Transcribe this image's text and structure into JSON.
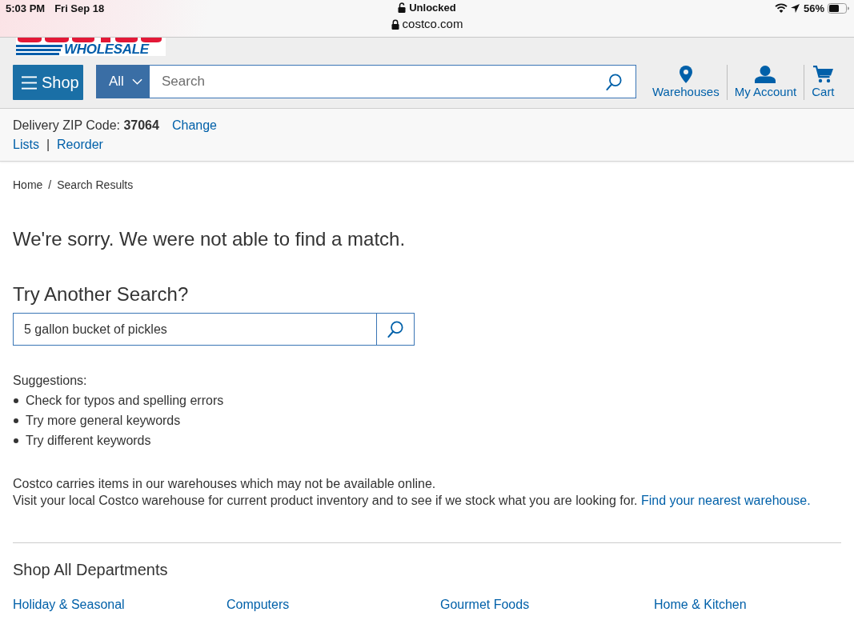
{
  "status_bar": {
    "time": "5:03 PM",
    "date": "Fri Sep 18",
    "lock_status": "Unlocked",
    "address": "costco.com",
    "battery": "56%"
  },
  "header": {
    "logo_text": "WHOLESALE",
    "shop_button": "Shop",
    "search_category": "All",
    "search_placeholder": "Search",
    "nav": [
      {
        "kind": "pin",
        "label": "Warehouses"
      },
      {
        "kind": "person",
        "label": "My Account"
      },
      {
        "kind": "cart",
        "label": "Cart"
      }
    ]
  },
  "delivery": {
    "zip_text": "Delivery ZIP Code: **37064**",
    "change_link": "Change",
    "links": [
      "Lists",
      "Reorder"
    ],
    "separator": "|"
  },
  "breadcrumb": {
    "items": [
      "Home",
      "Search Results"
    ],
    "separator": "/"
  },
  "no_results_message": "We're sorry. We were not able to find a match.",
  "retry_search": {
    "title": "Try Another Search?",
    "query": "5 gallon bucket of pickles"
  },
  "suggestions": {
    "title": "Suggestions:",
    "items": [
      "Check for typos and spelling errors",
      "Try more general keywords",
      "Try different keywords"
    ]
  },
  "notice": {
    "text": "Costco carries items in our warehouses which may not be available online.",
    "visit_text": "Visit your local Costco warehouse for current product inventory and to see if we stock what you are looking for.",
    "link": "Find your nearest warehouse."
  },
  "departments": {
    "title": "Shop All Departments",
    "items": [
      "Holiday & Seasonal",
      "Computers",
      "Gourmet Foods",
      "Home & Kitchen"
    ]
  }
}
